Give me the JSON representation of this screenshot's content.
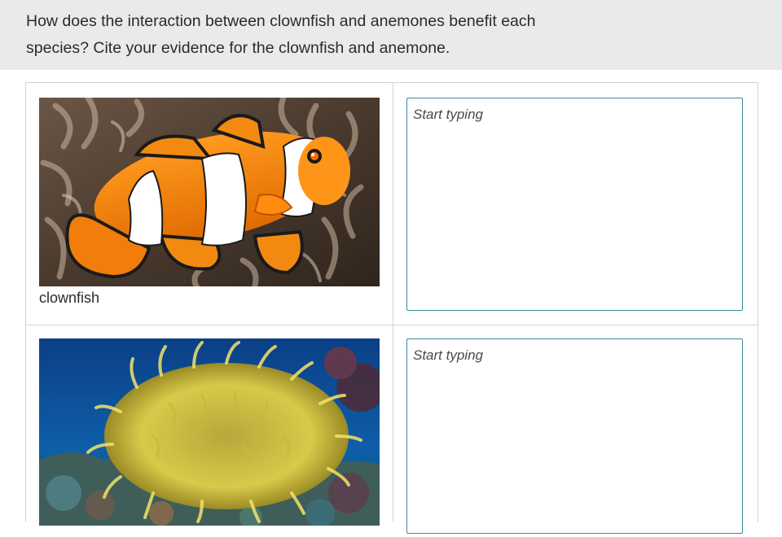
{
  "prompt": {
    "question": "How does the interaction between clownfish and anemones benefit each species? Cite your evidence for the clownfish and anemone."
  },
  "rows": [
    {
      "image": {
        "subject": "clownfish-photo"
      },
      "caption": "clownfish",
      "answer": {
        "value": "",
        "placeholder": "Start typing"
      }
    },
    {
      "image": {
        "subject": "anemone-photo"
      },
      "caption": "",
      "answer": {
        "value": "",
        "placeholder": "Start typing"
      }
    }
  ],
  "colors": {
    "prompt_bg": "#e9eaeb",
    "input_border": "#3a8a97",
    "grid_border": "#d4d4d4"
  }
}
